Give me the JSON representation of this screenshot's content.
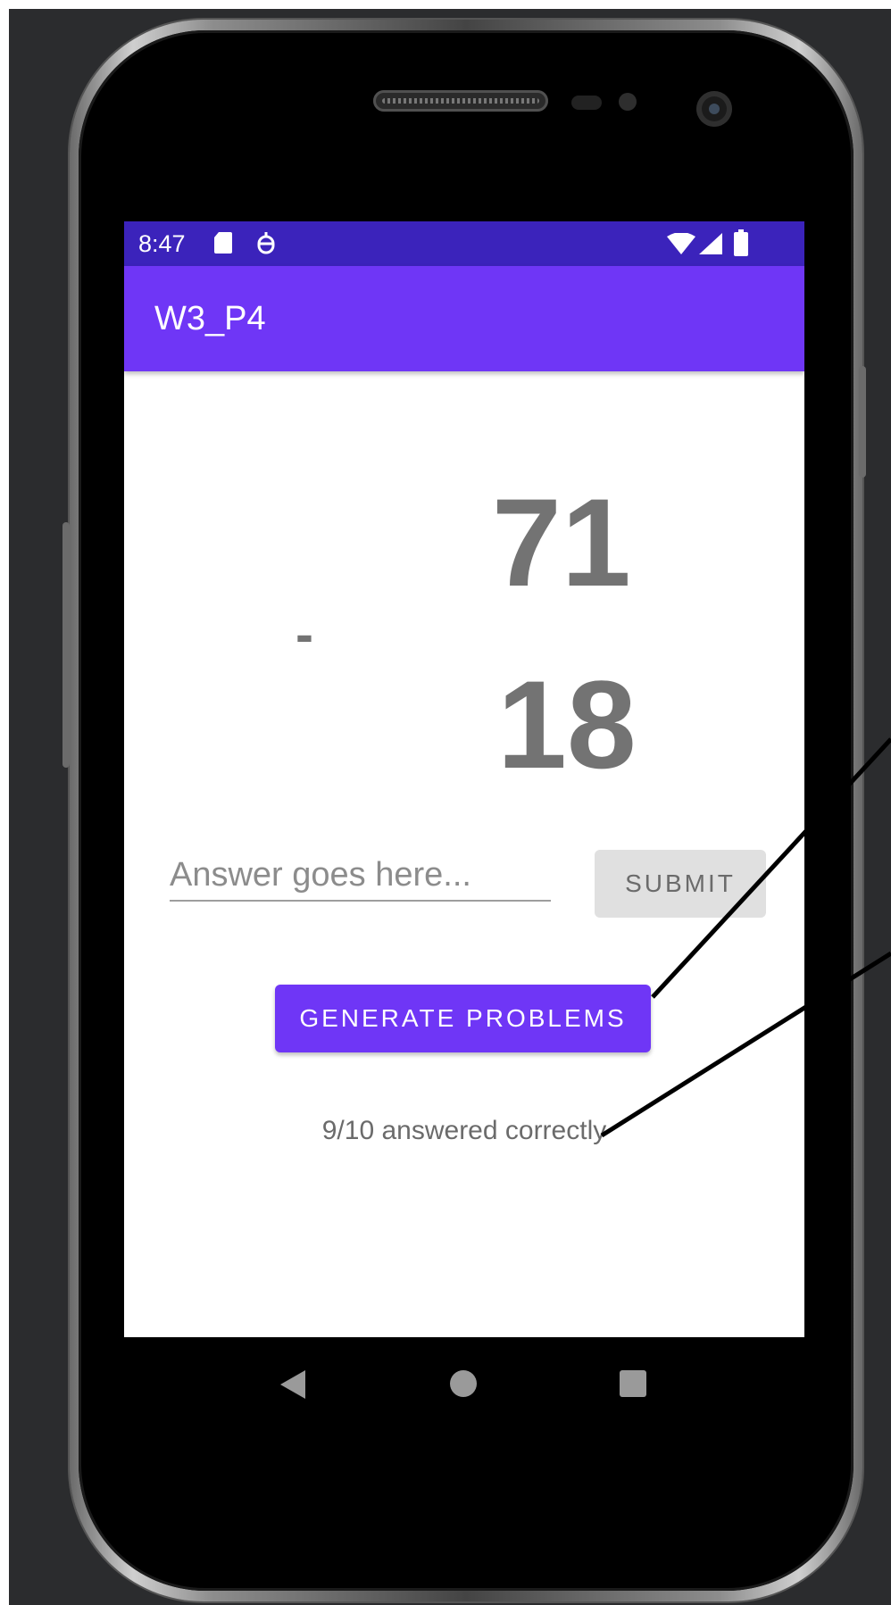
{
  "status_bar": {
    "time": "8:47",
    "icons": [
      "sd-card-icon",
      "notification-icon",
      "wifi-icon",
      "cell-signal-icon",
      "battery-icon"
    ]
  },
  "app_bar": {
    "title": "W3_P4"
  },
  "problem": {
    "top_number": "71",
    "operator": "-",
    "bottom_number": "18"
  },
  "answer": {
    "placeholder": "Answer goes here...",
    "value": ""
  },
  "buttons": {
    "submit": "SUBMIT",
    "generate": "GENERATE PROBLEMS"
  },
  "score": {
    "text": "9/10 answered correctly"
  },
  "colors": {
    "status_bar": "#3b23bb",
    "app_bar": "#6f36f6",
    "primary": "#6f36f6",
    "text_gray": "#737373"
  },
  "nav": [
    "back-icon",
    "home-icon",
    "recents-icon"
  ]
}
